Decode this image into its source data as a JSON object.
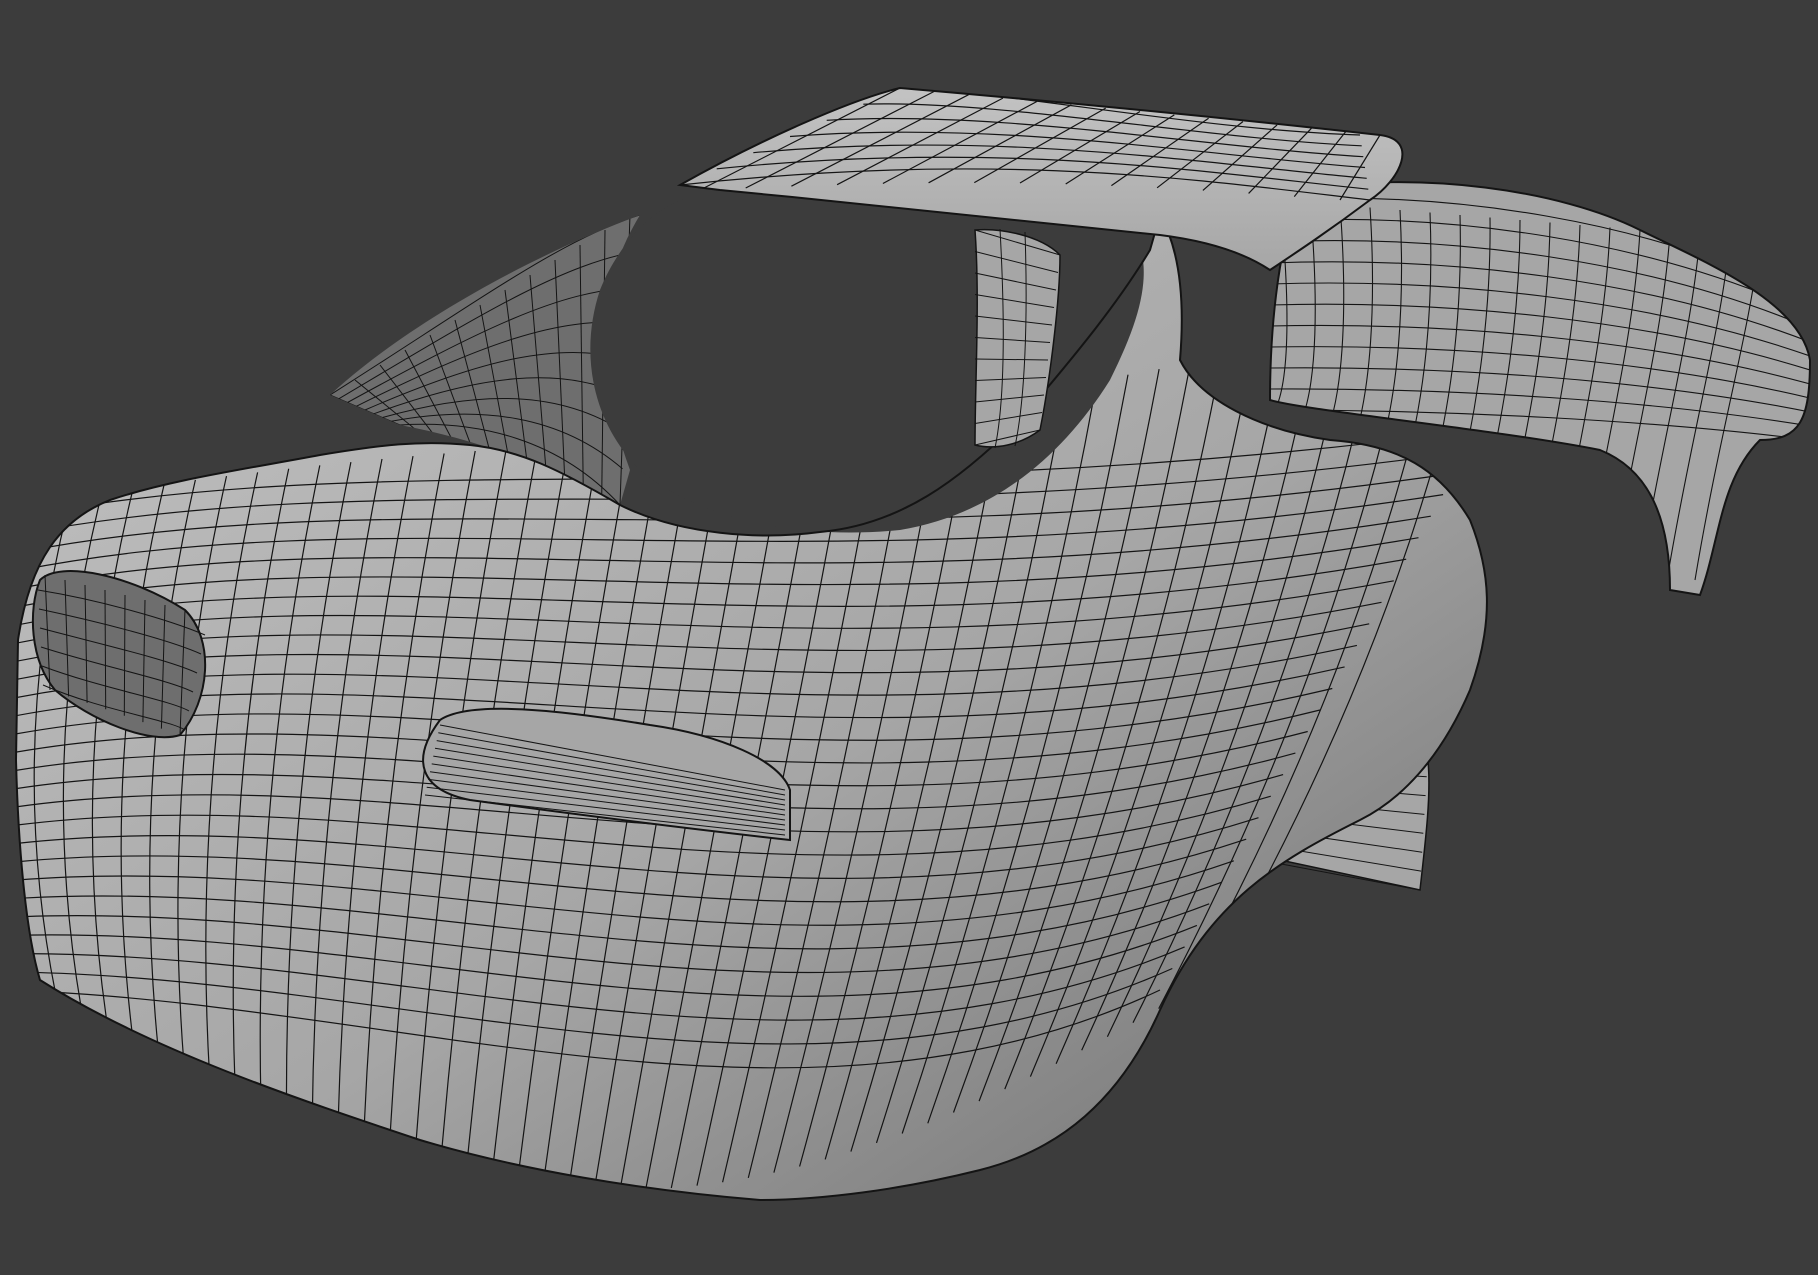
{
  "viewport": {
    "shading": "solid",
    "overlay": "wireframe",
    "background_color": "#3c3c3c",
    "mesh_fill_color": "#a6a6a6",
    "mesh_light_color": "#c3c3c3",
    "mesh_shadow_color": "#6e6e6e",
    "wire_color": "#141414",
    "mesh_icon": "car-body-mesh"
  }
}
